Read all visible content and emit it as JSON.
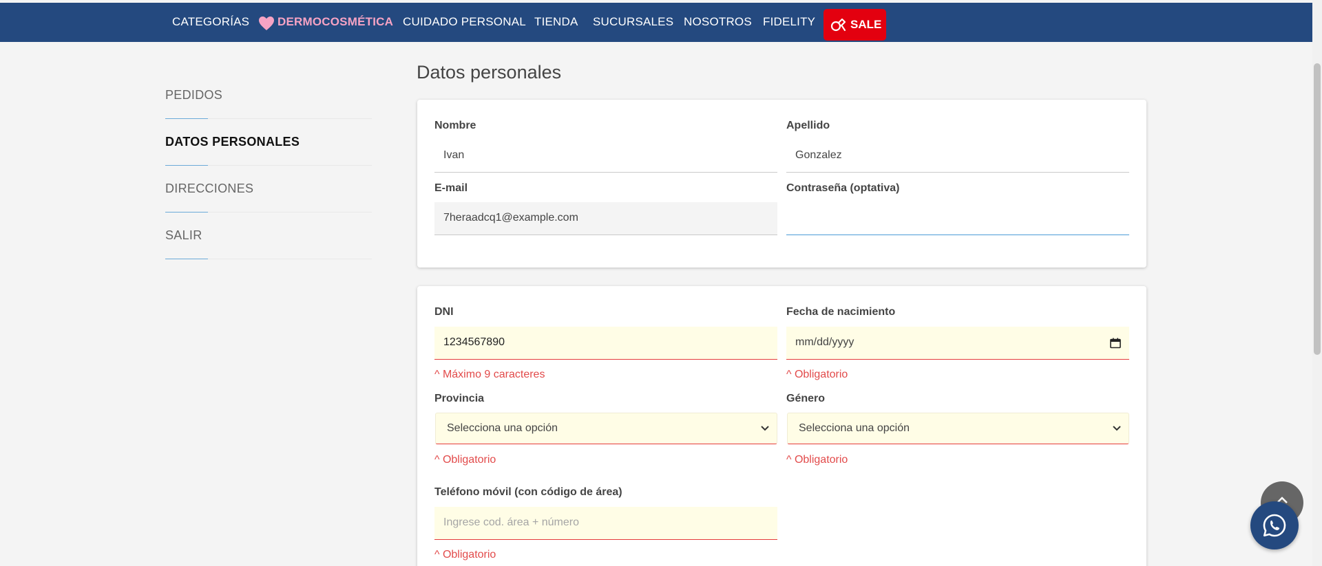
{
  "nav": {
    "items": [
      {
        "label": "CATEGORÍAS"
      },
      {
        "label": "DERMOCOSMÉTICA"
      },
      {
        "label": "CUIDADO PERSONAL"
      },
      {
        "label": "TIENDA"
      },
      {
        "label": "SUCURSALES"
      },
      {
        "label": "NOSOTROS"
      },
      {
        "label": "FIDELITY"
      }
    ],
    "sale_label": "SALE",
    "heart_icon": "heart-icon",
    "sale_icon": "sale-tag-icon"
  },
  "sidebar": {
    "items": [
      {
        "label": "PEDIDOS",
        "active": false
      },
      {
        "label": "DATOS PERSONALES",
        "active": true
      },
      {
        "label": "DIRECCIONES",
        "active": false
      },
      {
        "label": "SALIR",
        "active": false
      }
    ]
  },
  "page": {
    "title": "Datos personales"
  },
  "account": {
    "nombre_label": "Nombre",
    "nombre_value": "Ivan",
    "apellido_label": "Apellido",
    "apellido_value": "Gonzalez",
    "email_label": "E-mail",
    "email_value": "7heraadcq1@example.com",
    "password_label": "Contraseña (optativa)",
    "password_value": ""
  },
  "personal": {
    "dni_label": "DNI",
    "dni_value": "1234567890",
    "dni_error": "^ Máximo 9 caracteres",
    "fecha_label": "Fecha de nacimiento",
    "fecha_placeholder": "mm/dd/yyyy",
    "fecha_error": "^ Obligatorio",
    "provincia_label": "Provincia",
    "provincia_value": "Selecciona una opción",
    "provincia_error": "^ Obligatorio",
    "genero_label": "Género",
    "genero_value": "Selecciona una opción",
    "genero_error": "^ Obligatorio",
    "telefono_label": "Teléfono móvil (con código de área)",
    "telefono_placeholder": "Ingrese cod. área + número",
    "telefono_error": "^ Obligatorio"
  },
  "colors": {
    "nav_bg": "#24497f",
    "sale_bg": "#e3000f",
    "accent_pink": "#f6a3c4",
    "error": "#e24a4a",
    "error_field_bg": "#fffde6"
  },
  "floating": {
    "scroll_top_icon": "arrow-up-icon",
    "whatsapp_icon": "whatsapp-icon"
  }
}
